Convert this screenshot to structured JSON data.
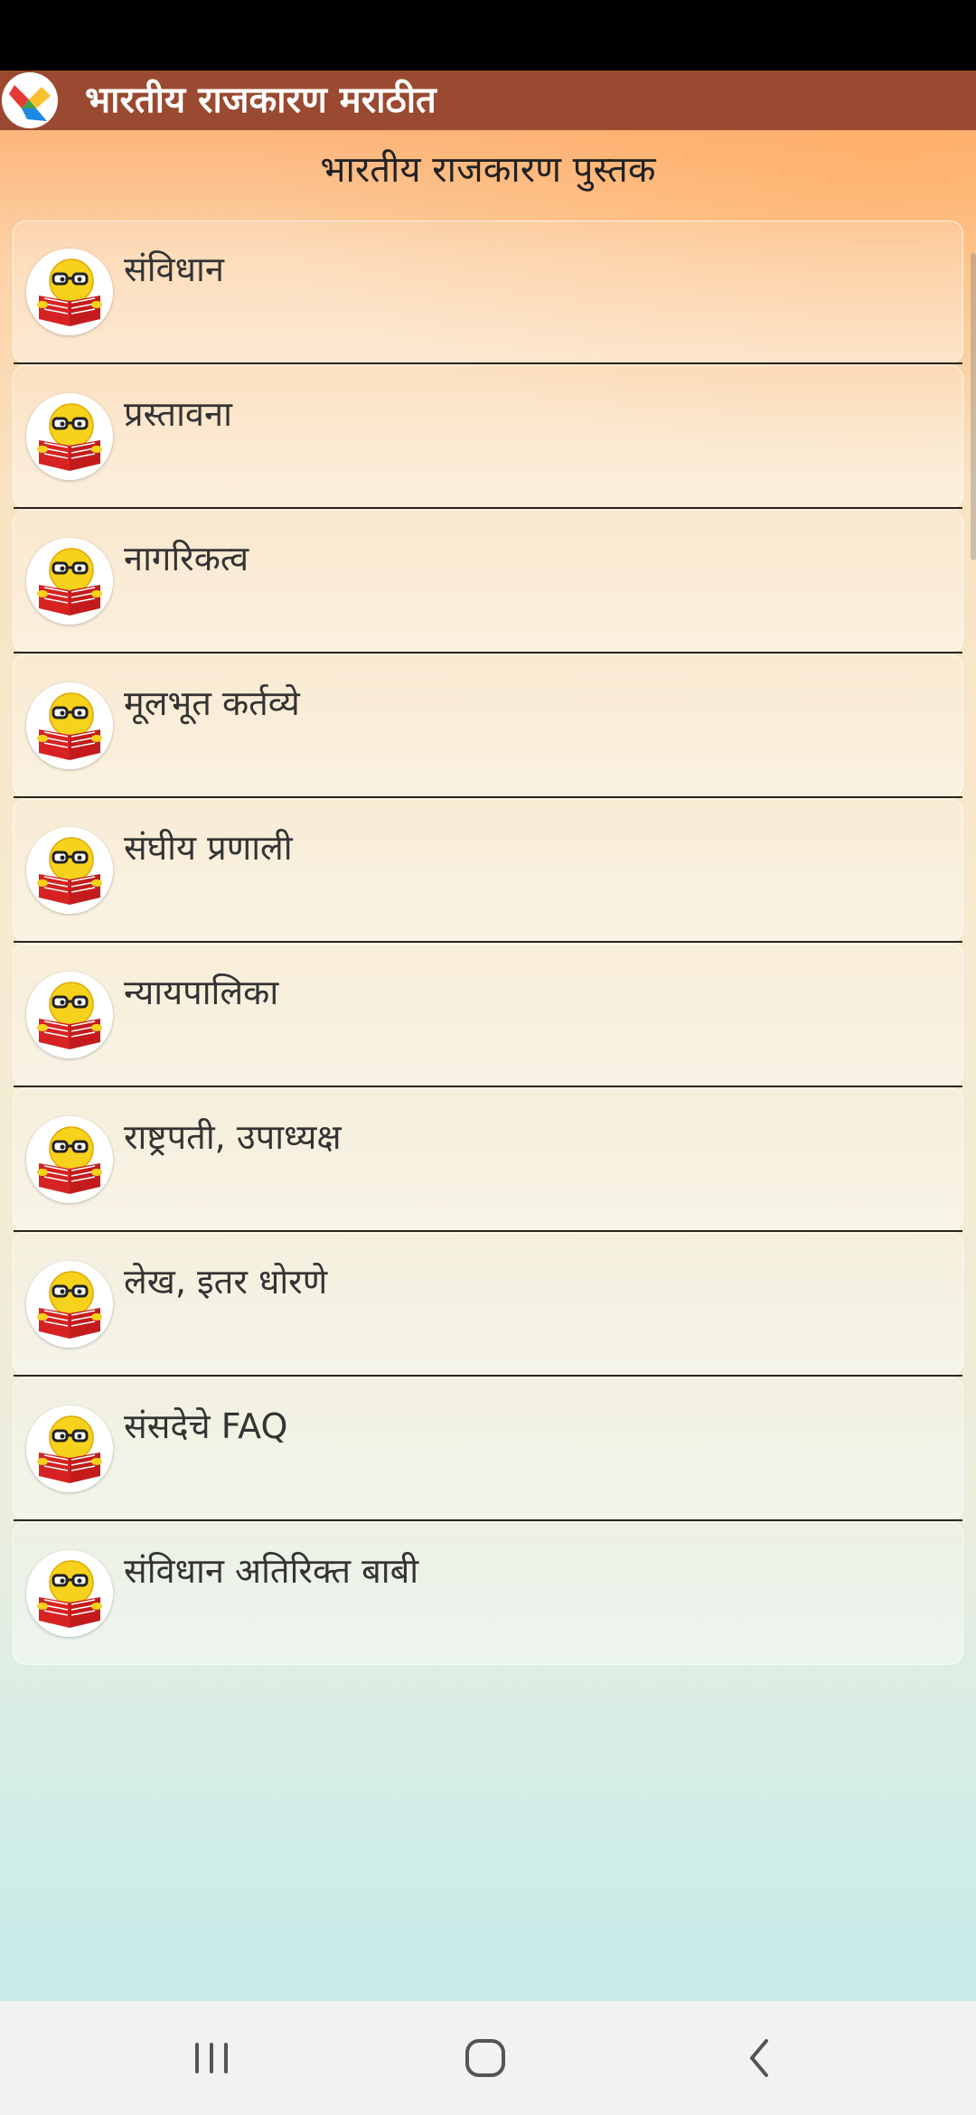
{
  "app_bar": {
    "title": "भारतीय राजकारण मराठीत",
    "color": "#994a30"
  },
  "page": {
    "heading": "भारतीय राजकारण पुस्तक"
  },
  "list": {
    "items": [
      {
        "label": "संविधान",
        "icon": "reading-emoji-icon"
      },
      {
        "label": "प्रस्तावना",
        "icon": "reading-emoji-icon"
      },
      {
        "label": "नागरिकत्व",
        "icon": "reading-emoji-icon"
      },
      {
        "label": "मूलभूत कर्तव्ये",
        "icon": "reading-emoji-icon"
      },
      {
        "label": "संघीय प्रणाली",
        "icon": "reading-emoji-icon"
      },
      {
        "label": "न्यायपालिका",
        "icon": "reading-emoji-icon"
      },
      {
        "label": "राष्ट्रपती, उपाध्यक्ष",
        "icon": "reading-emoji-icon"
      },
      {
        "label": "लेख, इतर धोरणे",
        "icon": "reading-emoji-icon"
      },
      {
        "label": "संसदेचे FAQ",
        "icon": "reading-emoji-icon"
      },
      {
        "label": "संविधान अतिरिक्त बाबी",
        "icon": "reading-emoji-icon"
      }
    ]
  },
  "nav_bar": {
    "buttons": [
      "recents-icon",
      "home-icon",
      "back-icon"
    ]
  }
}
